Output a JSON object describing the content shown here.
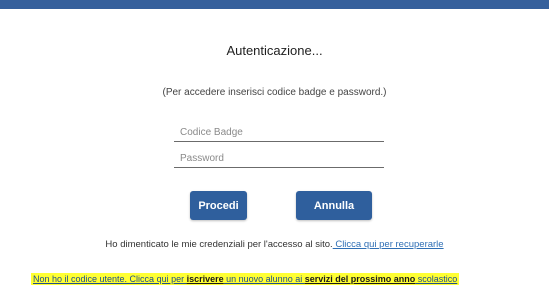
{
  "header": {
    "bar_color": "#35609c"
  },
  "auth": {
    "title": "Autenticazione...",
    "subtitle": "(Per accedere inserisci codice badge e password.)",
    "badge_placeholder": "Codice Badge",
    "badge_value": "",
    "password_placeholder": "Password",
    "password_value": ""
  },
  "buttons": {
    "procedi": "Procedi",
    "annulla": "Annulla",
    "color": "#2f5f9d"
  },
  "forgot": {
    "text": "Ho dimenticato le mie credenziali per l'accesso al sito.",
    "link": " Clicca qui per recuperarle"
  },
  "register": {
    "part1": "Non ho il codice utente. Clicca qui per ",
    "bold1": "iscrivere",
    "part2": " un nuovo alunno ai ",
    "bold2": "servizi del prossimo anno",
    "part3": " scolastico",
    "highlight_color": "#ffff33"
  }
}
